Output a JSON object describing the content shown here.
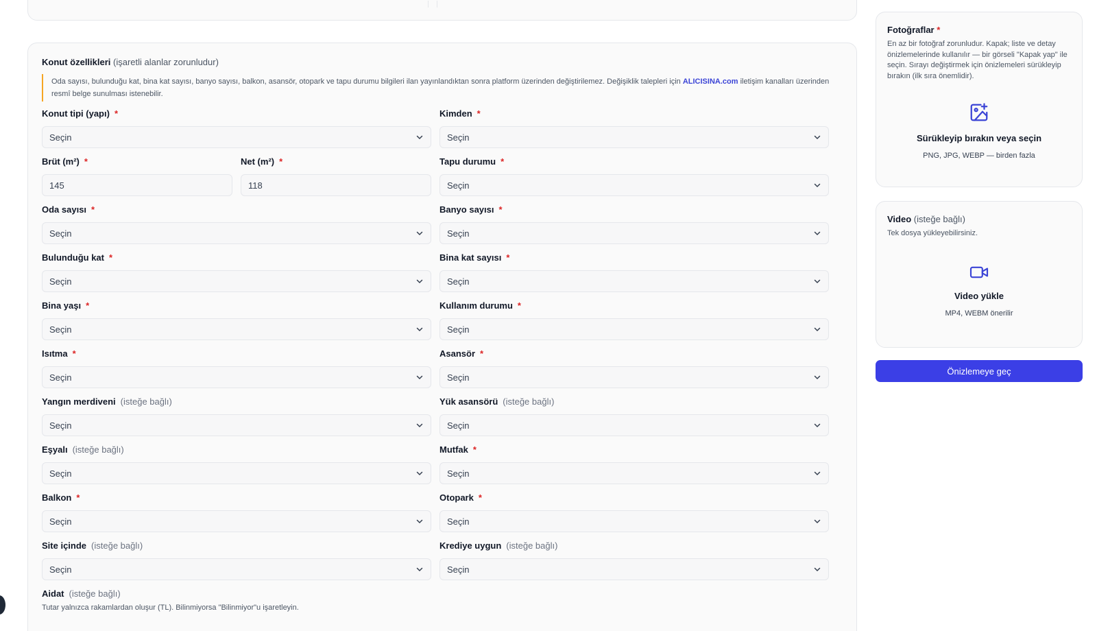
{
  "form": {
    "title": "Konut özellikleri",
    "title_note": "(işaretli alanlar zorunludur)",
    "info_text": "Oda sayısı, bulunduğu kat, bina kat sayısı, banyo sayısı, balkon, asansör, otopark ve tapu durumu bilgileri ilan yayınlandıktan sonra platform üzerinden değiştirilemez. Değişiklik talepleri için",
    "info_brand": "ALICISINA.com",
    "info_text_end": "iletişim kanalları üzerinden resmî belge sunulması istenebilir.",
    "required_mark": "*",
    "optional_text": "(isteğe bağlı)",
    "select_placeholder": "Seçin",
    "fields": {
      "konut_tipi": "Konut tipi (yapı)",
      "kimden": "Kimden",
      "brut": "Brüt (m²)",
      "brut_value": "145",
      "net": "Net (m²)",
      "net_value": "118",
      "tapu": "Tapu durumu",
      "oda": "Oda sayısı",
      "banyo": "Banyo sayısı",
      "kat": "Bulunduğu kat",
      "bina_kat": "Bina kat sayısı",
      "bina_yasi": "Bina yaşı",
      "kullanim": "Kullanım durumu",
      "isitma": "Isıtma",
      "asansor": "Asansör",
      "yangin": "Yangın merdiveni",
      "yuk_asansor": "Yük asansörü",
      "esyali": "Eşyalı",
      "mutfak": "Mutfak",
      "balkon": "Balkon",
      "otopark": "Otopark",
      "site": "Site içinde",
      "krediye": "Krediye uygun",
      "aidat": "Aidat",
      "aidat_hint": "Tutar yalnızca rakamlardan oluşur (TL). Bilinmiyorsa \"Bilinmiyor\"u işaretleyin."
    }
  },
  "photos": {
    "title": "Fotoğraflar",
    "required_mark": "*",
    "desc": "En az bir fotoğraf zorunludur. Kapak; liste ve detay önizlemelerinde kullanılır — bir görseli \"Kapak yap\" ile seçin. Sırayı değiştirmek için önizlemeleri sürükleyip bırakın (ilk sıra önemlidir).",
    "drop_title": "Sürükleyip bırakın veya seçin",
    "drop_sub": "PNG, JPG, WEBP — birden fazla",
    "icon": "image-plus-icon"
  },
  "video": {
    "title": "Video",
    "title_note": "(isteğe bağlı)",
    "desc": "Tek dosya yükleyebilirsiniz.",
    "drop_title": "Video yükle",
    "drop_sub": "MP4, WEBM önerilir",
    "icon": "video-camera-icon"
  },
  "actions": {
    "preview_label": "Önizlemeye geç"
  },
  "colors": {
    "accent": "#3b3fe6",
    "required": "#dc2626",
    "info_border": "#f5a524"
  }
}
